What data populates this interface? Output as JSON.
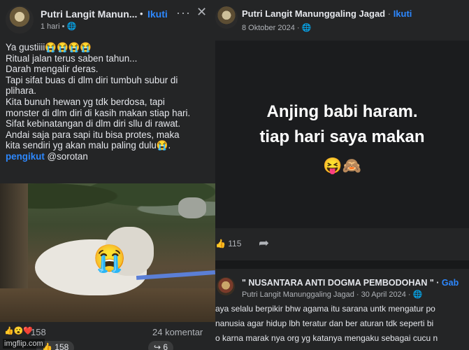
{
  "left_post": {
    "author": "Putri Langit Manun...",
    "dot": "•",
    "follow": "Ikuti",
    "meta": "1 hari • 🌐",
    "more_icon": "more-icon",
    "close_icon": "close-icon",
    "text_lines": [
      "Ya gustiiii😭😭😭😭",
      "Ritual jalan terus saben tahun...",
      "Darah mengalir deras.",
      "Tapi sifat buas di dlm diri tumbuh subur di",
      "plihara.",
      "Kita bunuh hewan yg tdk berdosa, tapi",
      "monster di dlm diri di kasih makan stiap hari.",
      "Sifat kebinatangan di dlm diri sllu di rawat.",
      "Andai saja para sapi itu bisa protes, maka",
      "kita sendiri yg akan malu paling dulu😭."
    ],
    "tag_word": "pengikut",
    "tag_rest": " @sorotan",
    "photo_emoji": "😭",
    "reaction_icons": "👍😮❤️",
    "reaction_count": "158",
    "comments": "24 komentar",
    "like_button": "👍 158",
    "share_button": "↪ 6",
    "watermark": "imgflip.com"
  },
  "right_post_1": {
    "author": "Putri Langit Manunggaling Jagad",
    "sep": " · ",
    "follow": "Ikuti",
    "meta": "8 Oktober 2024 · 🌐",
    "card_line_1": "Anjing babi haram.",
    "card_line_2": "tiap hari saya makan",
    "card_emojis": "😝🙈",
    "likes": "👍 115",
    "share_icon": "share-icon",
    "share_glyph": "➦"
  },
  "right_post_2": {
    "title": "\" NUSANTARA ANTI DOGMA PEMBODOHAN \" · ",
    "title_follow": "Gab",
    "meta": "Putri Langit Manunggaling Jagad · 30 April 2024 · 🌐",
    "text_lines": [
      "aya selalu berpikir bhw agama itu sarana untk mengatur po",
      "nanusia agar hidup lbh teratur dan ber aturan tdk seperti bi",
      "o karna marak nya org yg katanya mengaku sebagai cucu n"
    ]
  },
  "colors": {
    "background": "#242526",
    "link_blue": "#2d88ff",
    "text": "#e4e6eb",
    "muted": "#b0b3b8"
  }
}
